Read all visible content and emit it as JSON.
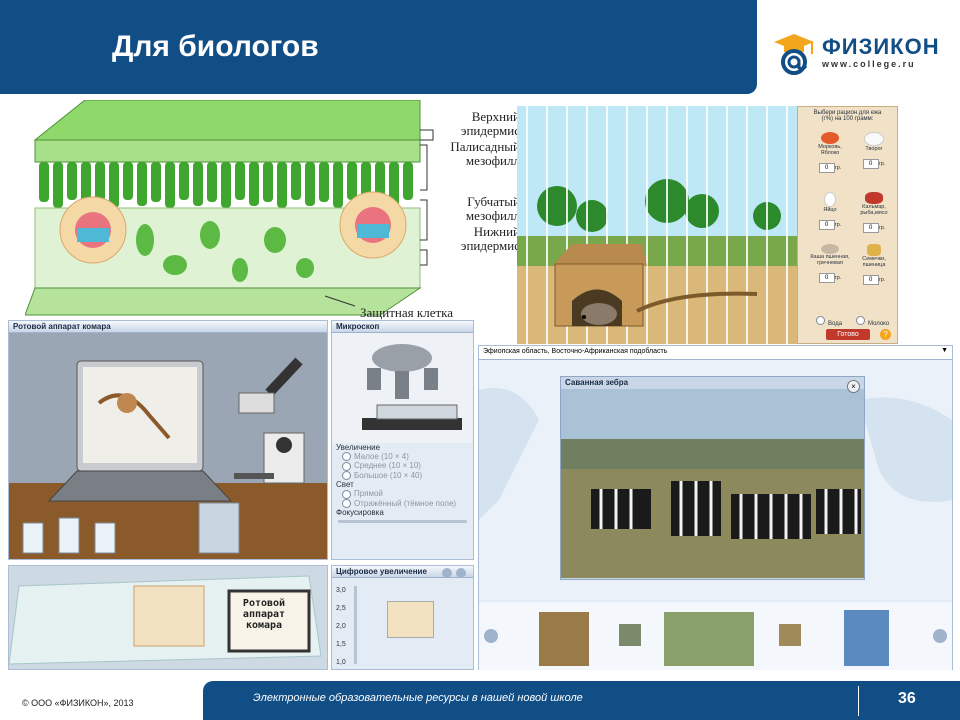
{
  "header": {
    "title": "Для биологов"
  },
  "logo": {
    "name": "ФИЗИКОН",
    "url": "www.college.ru"
  },
  "leaf": {
    "labels": [
      "Верхний эпидермис",
      "Палисадный мезофилл",
      "Губчатый мезофилл",
      "Нижний эпидермис"
    ],
    "guard_cell": "Защитная клетка"
  },
  "hedgehog": {
    "header": "Выбери рацион для ежа",
    "subheader": "(г%) на 100 грамм:",
    "foods": [
      {
        "label": "Морковь, Яблоко",
        "value": "0",
        "unit": "гр."
      },
      {
        "label": "Творог",
        "value": "0",
        "unit": "гр."
      },
      {
        "label": "Яйцо",
        "value": "0",
        "unit": "гр."
      },
      {
        "label": "Кальмар, рыба,мясо",
        "value": "0",
        "unit": "гр."
      },
      {
        "label": "Каша пшенная, гречневая",
        "value": "0",
        "unit": "гр."
      },
      {
        "label": "Семечки, пшеница",
        "value": "0",
        "unit": "гр."
      }
    ],
    "drinks": [
      "Вода",
      "Молоко"
    ],
    "ready": "Готово",
    "help": "?"
  },
  "mosquito": {
    "title": "Ротовой аппарат комара",
    "slide_text": "Ротовой аппарат комара"
  },
  "microscope": {
    "title": "Микроскоп",
    "magnification_label": "Увеличение",
    "magnifications": [
      "Малое (10 × 4)",
      "Среднее (10 × 10)",
      "Большое (10 × 40)"
    ],
    "light_label": "Свет",
    "lights": [
      "Прямой",
      "Отражённый (тёмное поле)"
    ],
    "focus_label": "Фокусировка"
  },
  "digital": {
    "title": "Цифровое увеличение",
    "scale": [
      "3,0",
      "2,5",
      "2,0",
      "1,5",
      "1,0"
    ]
  },
  "zebra": {
    "dropdown": "Эфиопская область, Восточно-Африканская подобласть",
    "caption": "Саванная зебра"
  },
  "footer": {
    "copyright": "© ООО «ФИЗИКОН», 2013",
    "text": "Электронные образовательные ресурсы в нашей новой школе",
    "page": "36"
  }
}
